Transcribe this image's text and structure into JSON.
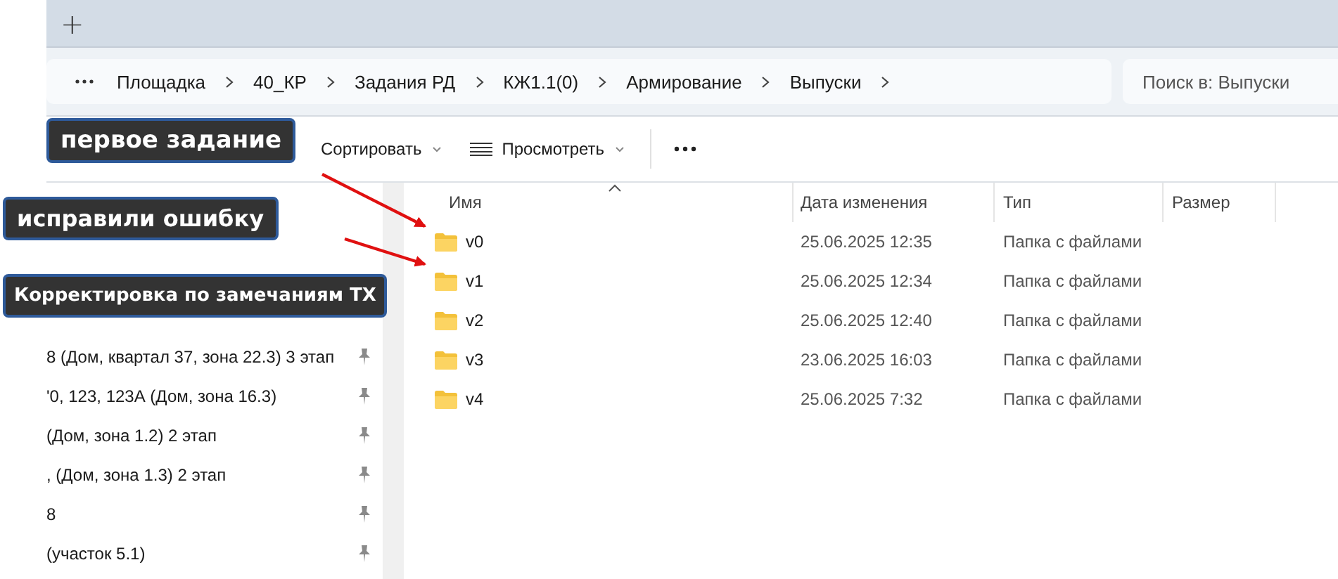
{
  "tab_bar": {
    "new_tab": "+"
  },
  "address_bar": {
    "breadcrumbs": [
      "Площадка",
      "40_КР",
      "Задания РД",
      "КЖ1.1(0)",
      "Армирование",
      "Выпуски"
    ]
  },
  "search": {
    "placeholder": "Поиск в: Выпуски"
  },
  "toolbar": {
    "buttons": [
      {
        "label": "Сортировать",
        "kind": "sort"
      },
      {
        "label": "Просмотреть",
        "kind": "view"
      }
    ]
  },
  "sidebar": {
    "items": [
      "8 (Дом, квартал 37, зона 22.3) 3 этап",
      "'0, 123, 123А (Дом, зона 16.3)",
      "(Дом, зона 1.2) 2 этап",
      ", (Дом, зона 1.3) 2 этап",
      "8",
      "(участок 5.1)"
    ]
  },
  "file_list": {
    "columns": [
      "Имя",
      "Дата изменения",
      "Тип",
      "Размер"
    ],
    "rows": [
      {
        "name": "v0",
        "modified": "25.06.2025 12:35",
        "type": "Папка с файлами"
      },
      {
        "name": "v1",
        "modified": "25.06.2025 12:34",
        "type": "Папка с файлами"
      },
      {
        "name": "v2",
        "modified": "25.06.2025 12:40",
        "type": "Папка с файлами"
      },
      {
        "name": "v3",
        "modified": "23.06.2025 16:03",
        "type": "Папка с файлами"
      },
      {
        "name": "v4",
        "modified": "25.06.2025 7:32",
        "type": "Папка с файлами"
      }
    ]
  },
  "callouts": [
    "первое задание",
    "исправили ошибку",
    "Корректировка по замечаниям ТХ"
  ]
}
